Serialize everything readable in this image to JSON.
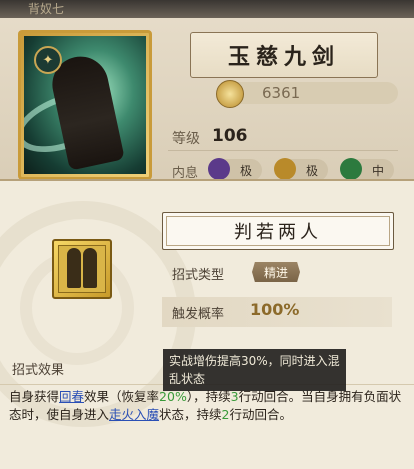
{
  "background": {
    "top_text": "背奴七",
    "hero_name": "玉慈九剑",
    "power": "6361",
    "level_label": "等级",
    "level_value": "106",
    "attr_label": "内息",
    "attrs": [
      {
        "label": "极",
        "color": "#5b3a8a"
      },
      {
        "label": "极",
        "color": "#b98a2a"
      },
      {
        "label": "中",
        "color": "#2c7a3e"
      }
    ]
  },
  "skill": {
    "name": "判若两人",
    "type_label": "招式类型",
    "type_value": "精进",
    "prob_label": "触发概率",
    "prob_value": "100%",
    "effect_header": "招式效果",
    "effect_parts": [
      {
        "text": "自身获得",
        "style": "plain"
      },
      {
        "text": "回春",
        "style": "link"
      },
      {
        "text": "效果（恢复率",
        "style": "plain"
      },
      {
        "text": "20%",
        "style": "green"
      },
      {
        "text": "），持续",
        "style": "plain"
      },
      {
        "text": "3",
        "style": "green"
      },
      {
        "text": "行动回合。当自身拥有负面状态时，使自身进入",
        "style": "plain"
      },
      {
        "text": "走火入魔",
        "style": "link"
      },
      {
        "text": "状态，持续",
        "style": "plain"
      },
      {
        "text": "2",
        "style": "green"
      },
      {
        "text": "行动回合。",
        "style": "plain"
      }
    ],
    "tooltip": "实战增伤提高30%，同时进入混乱状态"
  }
}
